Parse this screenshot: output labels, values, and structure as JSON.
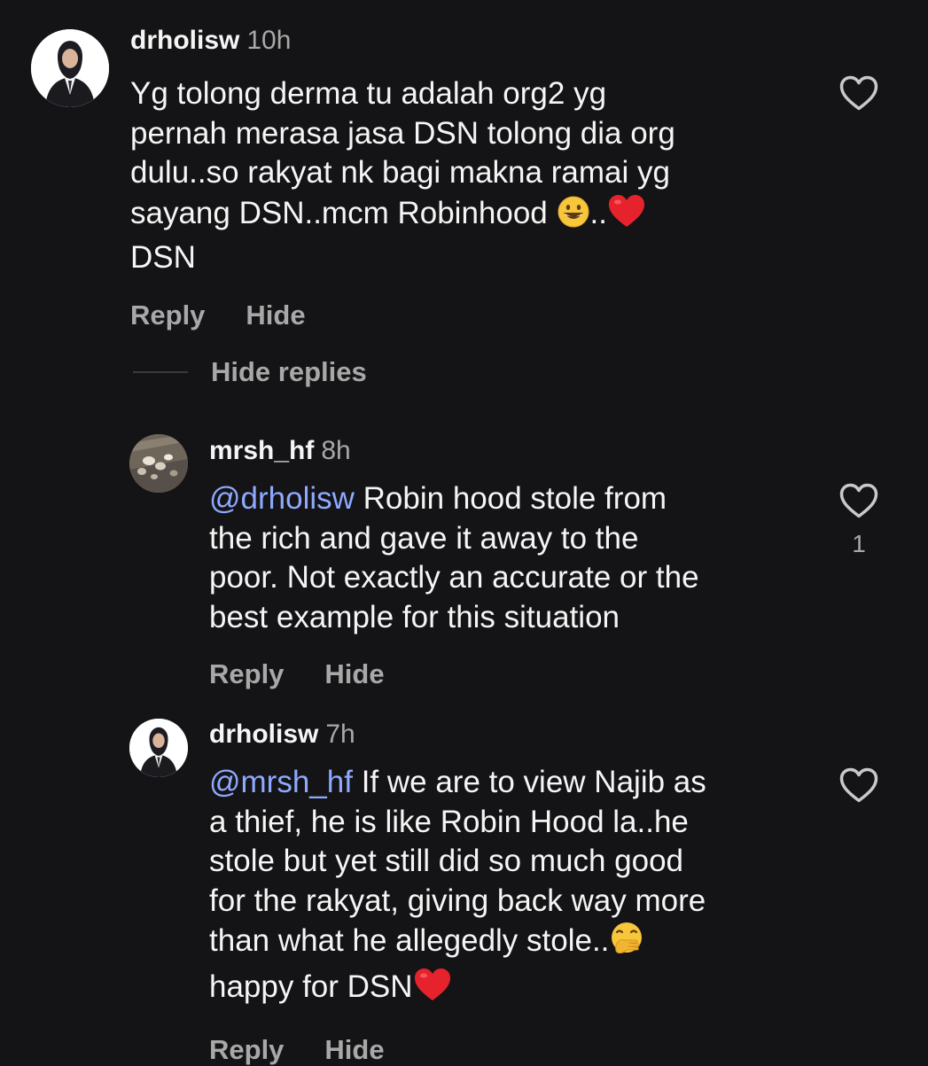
{
  "comments": [
    {
      "username": "drholisw",
      "time": "10h",
      "text_lines": [
        "Yg tolong derma tu adalah org2 yg",
        "pernah merasa jasa DSN tolong dia org",
        "dulu..so rakyat nk bagi makna ramai yg",
        "sayang DSN..mcm Robinhood",
        "DSN"
      ],
      "text_after_emoji1": "..",
      "emoji1": "grinning-face",
      "emoji2": "red-heart",
      "reply_label": "Reply",
      "hide_label": "Hide",
      "avatar": "woman-in-hijab-suit"
    }
  ],
  "hide_replies_label": "Hide replies",
  "replies": [
    {
      "username": "mrsh_hf",
      "time": "8h",
      "mention": "@drholisw",
      "text_first": " Robin hood stole from",
      "text_lines": [
        "the rich and gave it away to the",
        "poor. Not exactly an accurate or the",
        "best example for this situation"
      ],
      "like_count": "1",
      "reply_label": "Reply",
      "hide_label": "Hide",
      "avatar": "pebbles-photo"
    },
    {
      "username": "drholisw",
      "time": "7h",
      "mention": "@mrsh_hf",
      "text_first": " If we are to view Najib as",
      "text_lines": [
        "a thief, he is like Robin Hood la..he",
        "stole but yet still did so much good",
        "for the rakyat, giving back way more",
        "than what he allegedly stole.."
      ],
      "text_last": "happy for DSN",
      "emoji1": "face-with-hand-over-mouth",
      "emoji2": "red-heart",
      "reply_label": "Reply",
      "hide_label": "Hide",
      "avatar": "woman-in-hijab-suit"
    }
  ],
  "colors": {
    "background": "#141416",
    "text": "#f5f5f5",
    "secondary": "#a8a8a8",
    "mention": "#8ea9ff"
  }
}
